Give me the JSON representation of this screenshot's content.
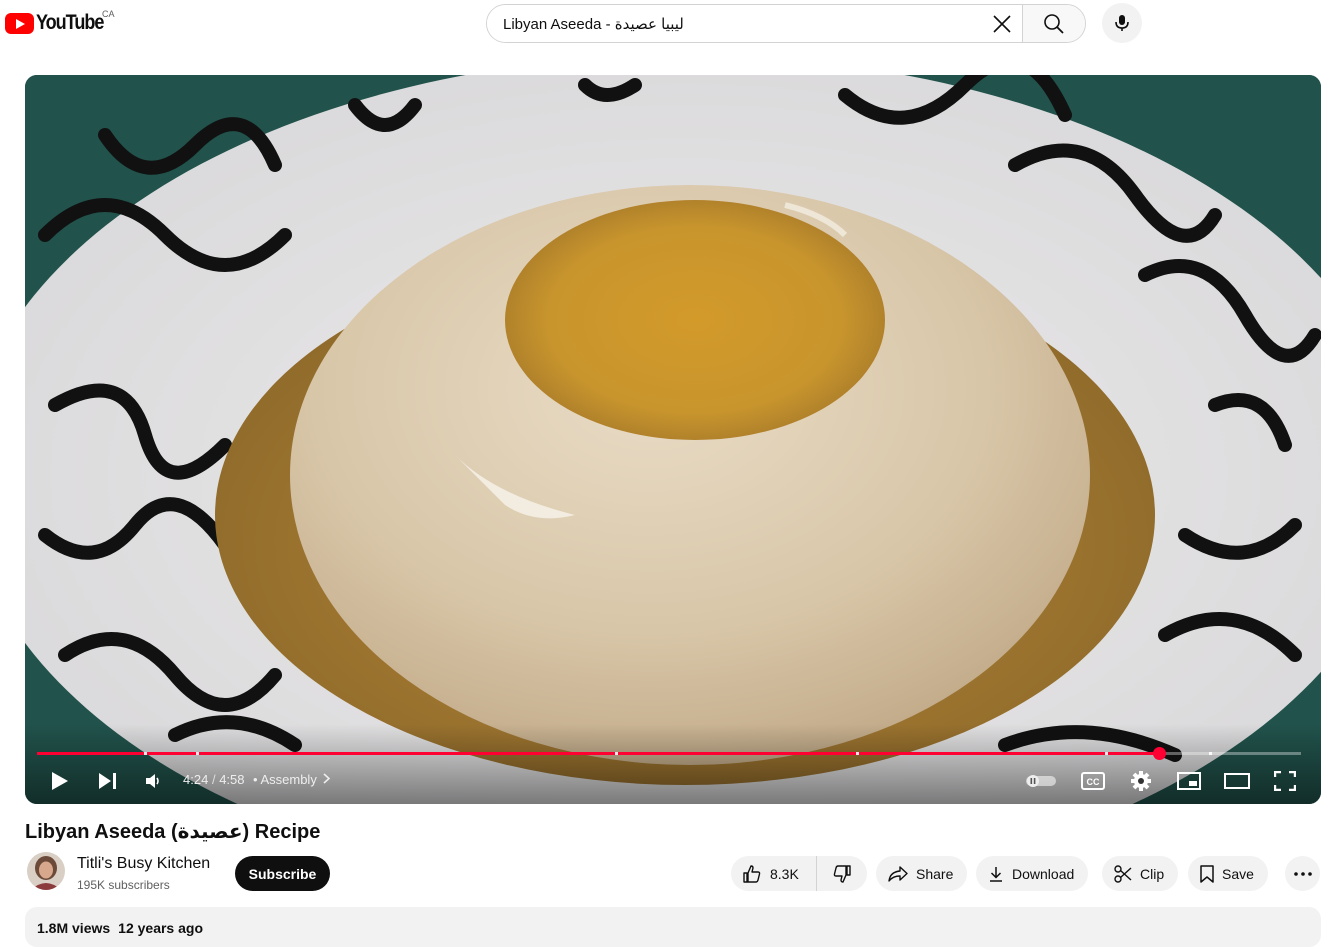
{
  "masthead": {
    "logo_text": "YouTube",
    "country_code": "CA",
    "search_value": "Libyan Aseeda - ليبيا عصيدة",
    "icons": [
      "youtube-logo-icon",
      "clear-icon",
      "search-icon",
      "microphone-icon"
    ]
  },
  "player": {
    "current_time": "4:24",
    "duration": "4:58",
    "time_separator": "/",
    "chapter_bullet": "•",
    "chapter": "Assembly",
    "progress_fraction": 0.888,
    "chapter_markers_fraction": [
      0.085,
      0.126,
      0.457,
      0.648,
      0.845,
      0.885,
      0.927
    ],
    "colors": {
      "progress": "#ff0033",
      "scrubber": "#ff0033"
    },
    "icons": [
      "play-icon",
      "next-icon",
      "volume-icon",
      "autoplay-toggle-icon",
      "captions-icon",
      "settings-icon",
      "miniplayer-icon",
      "theater-mode-icon",
      "fullscreen-icon"
    ]
  },
  "video": {
    "title": "Libyan Aseeda (عصيدة) Recipe"
  },
  "channel": {
    "name": "Titli's Busy Kitchen",
    "subscribers": "195K subscribers",
    "subscribe_label": "Subscribe"
  },
  "actions": {
    "likes": "8.3K",
    "share": "Share",
    "download": "Download",
    "clip": "Clip",
    "save": "Save",
    "icons": [
      "like-icon",
      "dislike-icon",
      "share-icon",
      "download-icon",
      "clip-icon",
      "save-icon",
      "more-icon"
    ]
  },
  "description": {
    "views": "1.8M views",
    "published": "12 years ago"
  }
}
